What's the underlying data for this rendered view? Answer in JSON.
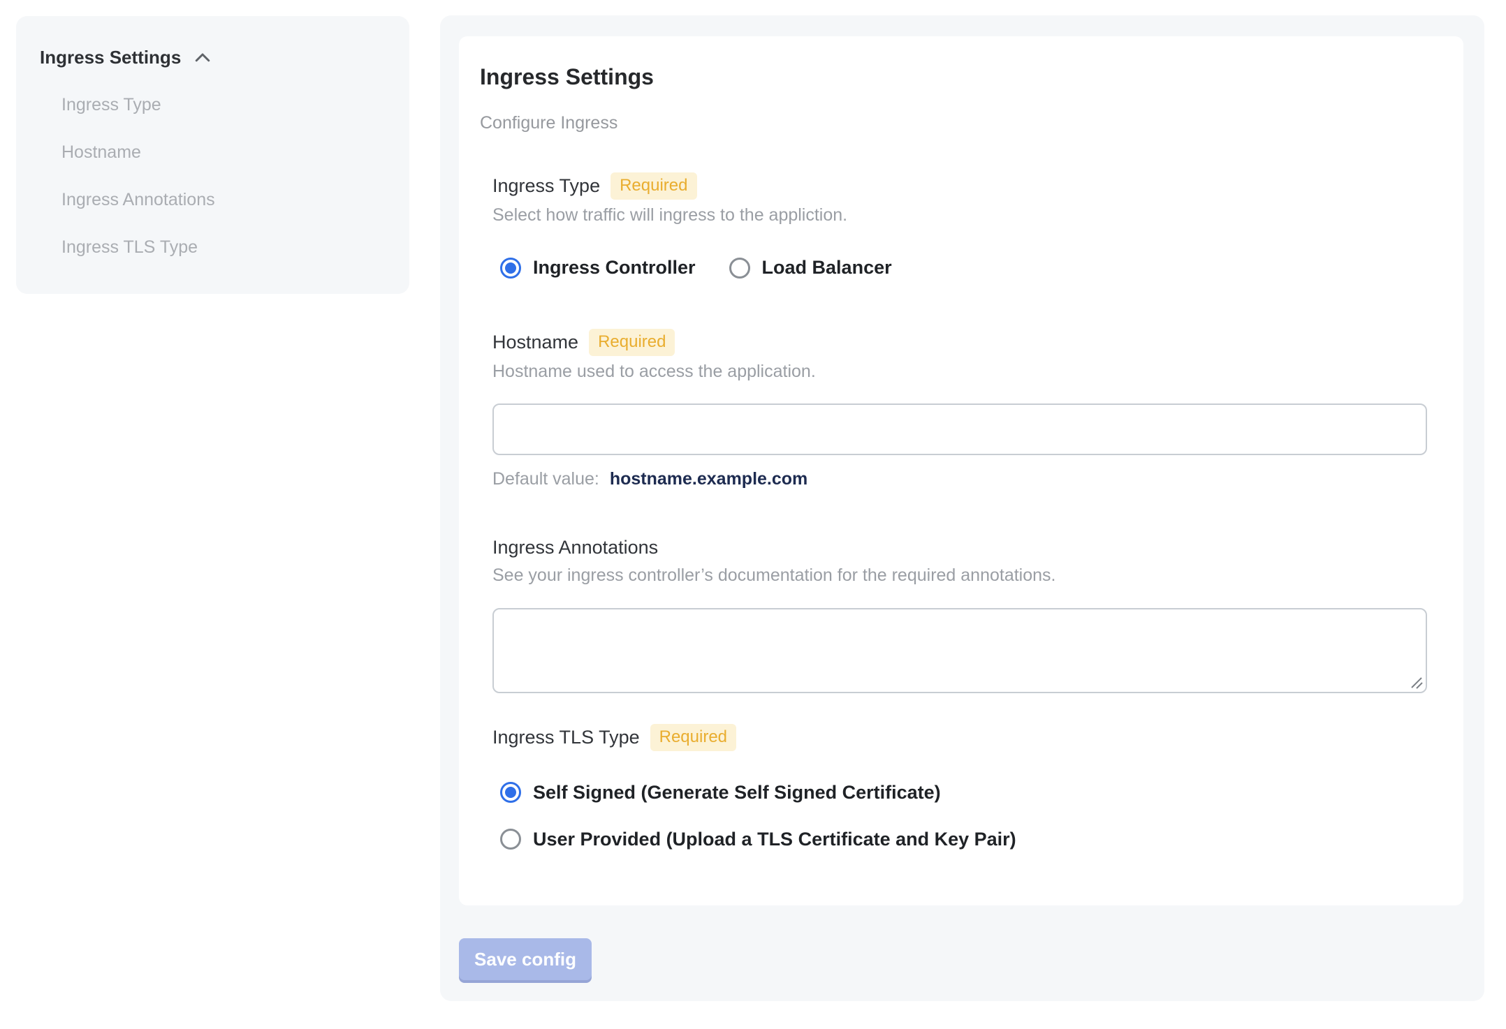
{
  "sidebar": {
    "header": "Ingress Settings",
    "items": [
      {
        "label": "Ingress Type"
      },
      {
        "label": "Hostname"
      },
      {
        "label": "Ingress Annotations"
      },
      {
        "label": "Ingress TLS Type"
      }
    ]
  },
  "main": {
    "title": "Ingress Settings",
    "subtitle": "Configure Ingress",
    "sections": {
      "ingress_type": {
        "label": "Ingress Type",
        "required_label": "Required",
        "help": "Select how traffic will ingress to the appliction.",
        "options": [
          {
            "label": "Ingress Controller",
            "selected": true
          },
          {
            "label": "Load Balancer",
            "selected": false
          }
        ]
      },
      "hostname": {
        "label": "Hostname",
        "required_label": "Required",
        "help": "Hostname used to access the application.",
        "value": "",
        "default_prefix": "Default value:",
        "default_value": "hostname.example.com"
      },
      "annotations": {
        "label": "Ingress Annotations",
        "help": "See your ingress controller’s documentation for the required annotations.",
        "value": ""
      },
      "tls": {
        "label": "Ingress TLS Type",
        "required_label": "Required",
        "options": [
          {
            "label": "Self Signed (Generate Self Signed Certificate)",
            "selected": true
          },
          {
            "label": "User Provided (Upload a TLS Certificate and Key Pair)",
            "selected": false
          }
        ]
      }
    },
    "save_button_label": "Save config"
  },
  "colors": {
    "panel_bg": "#f5f7f9",
    "accent_blue": "#2f6fe8",
    "badge_bg": "#fcf2d6",
    "badge_text": "#e9ad2f",
    "default_value_navy": "#1d2b50",
    "save_button_bg": "#a9b9e8"
  }
}
